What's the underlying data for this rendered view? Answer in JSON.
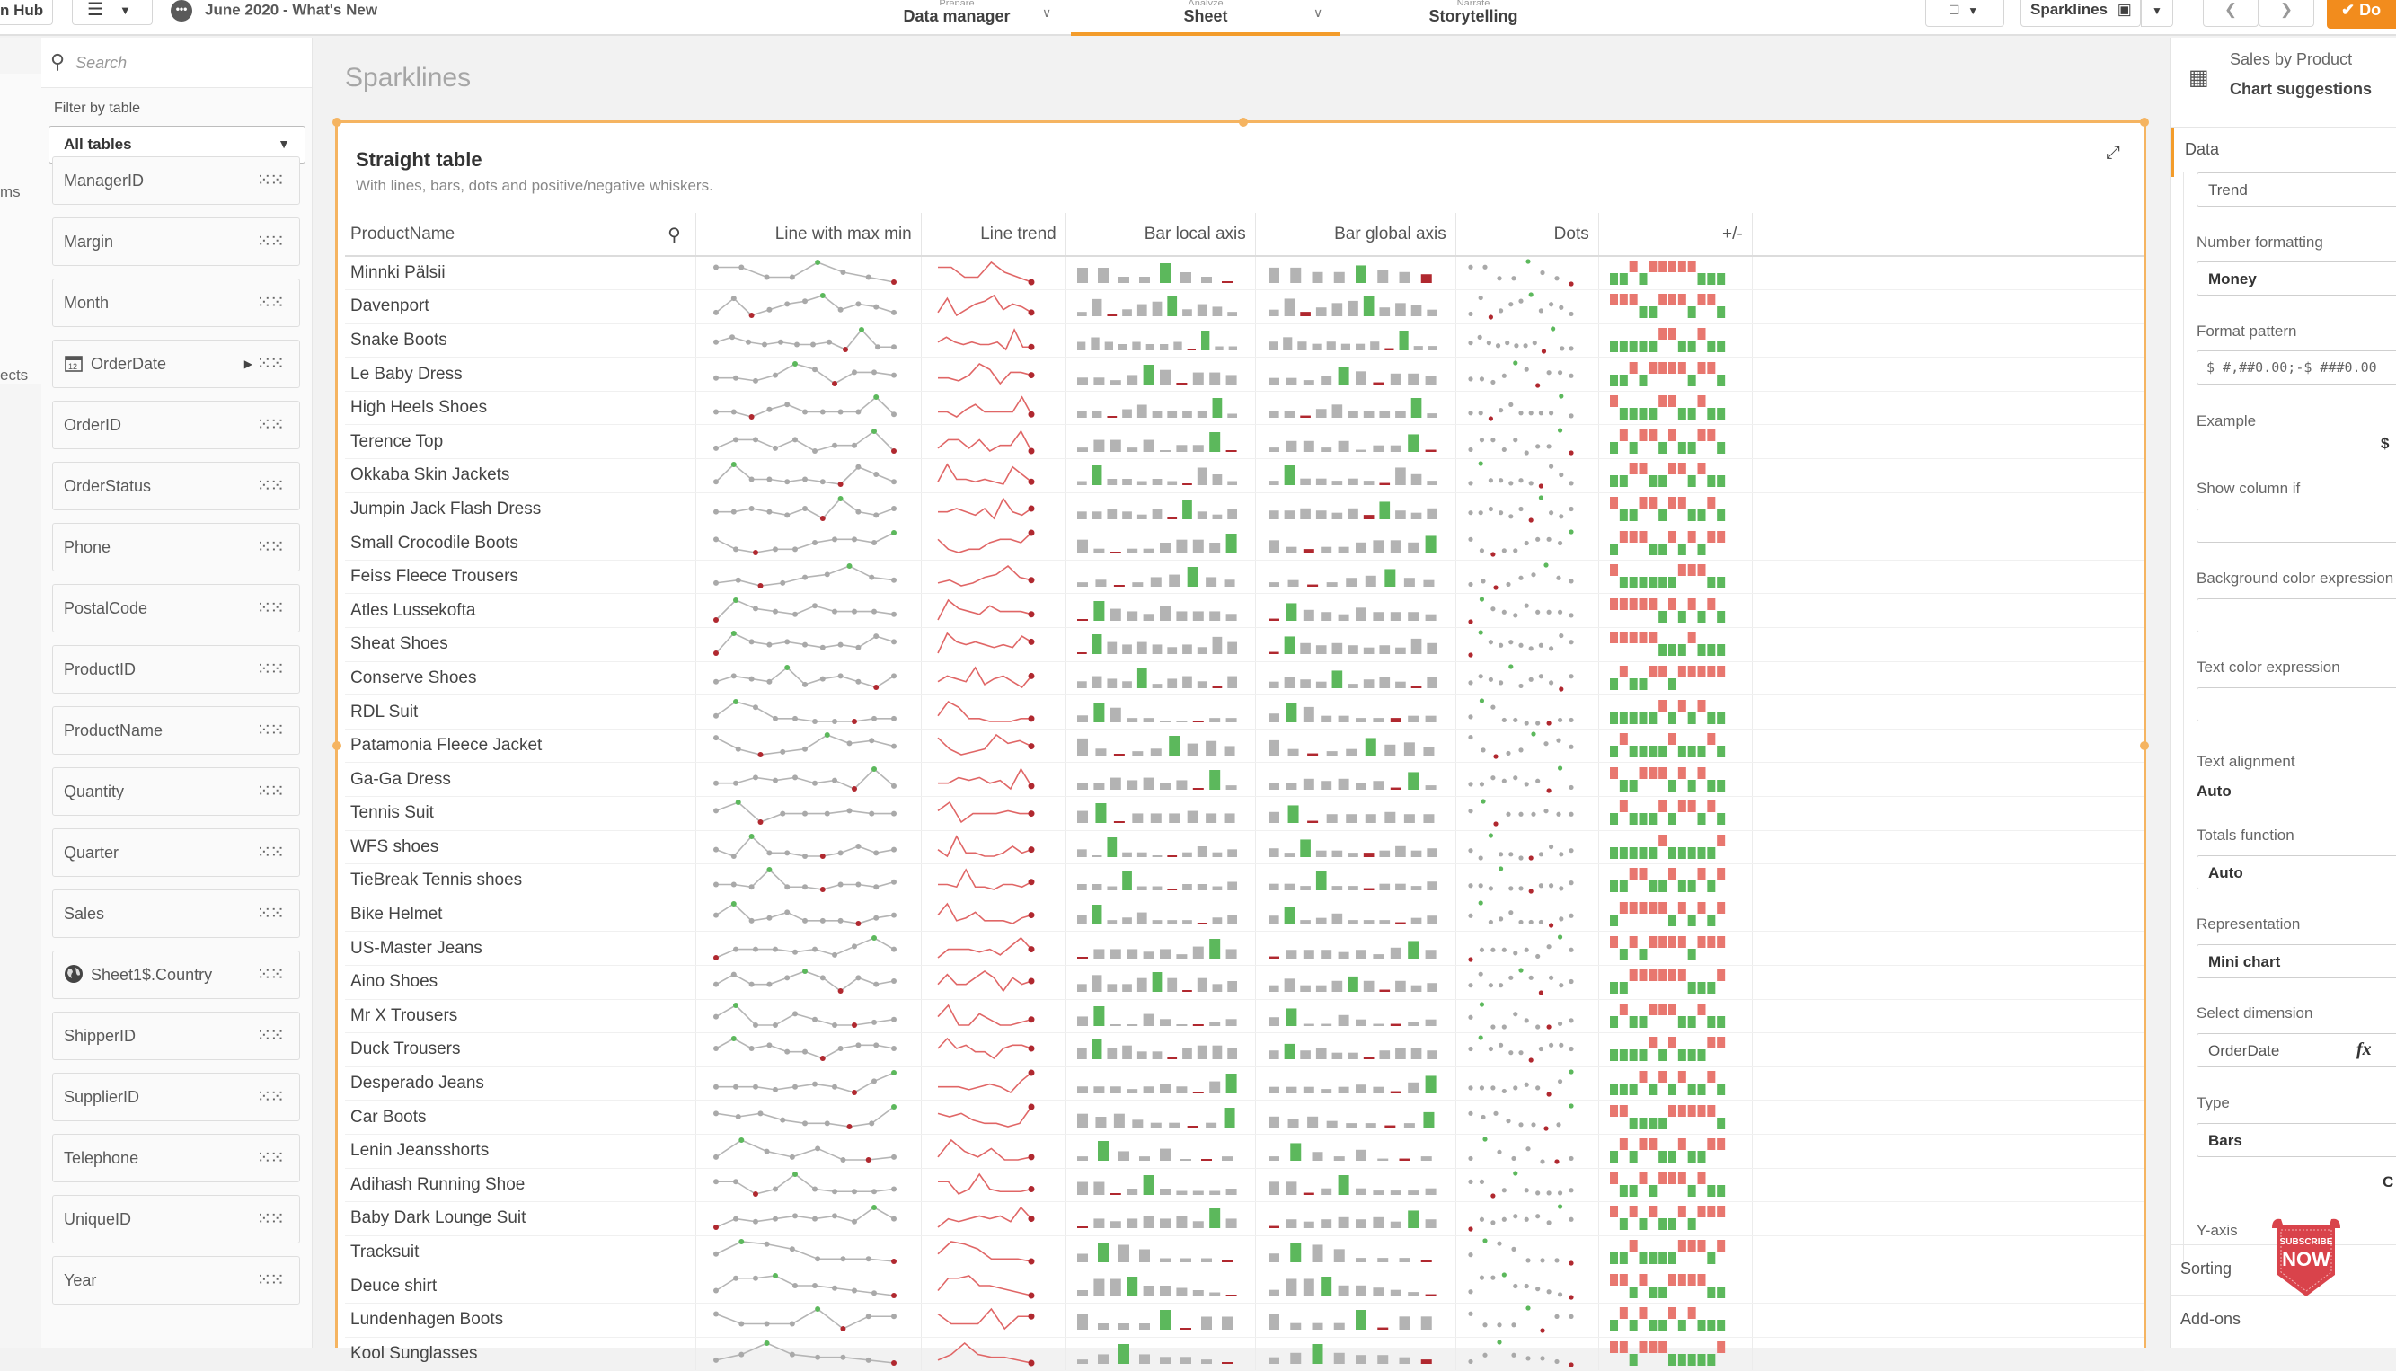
{
  "topbar": {
    "hub_label": "n Hub",
    "app_title": "June 2020 - What's New",
    "tabs": [
      {
        "small": "Prepare",
        "label": "Data manager",
        "active": false
      },
      {
        "small": "Analyze",
        "label": "Sheet",
        "active": true
      },
      {
        "small": "Narrate",
        "label": "Storytelling",
        "active": false
      }
    ],
    "sheet_selector": "Sparklines",
    "done_label": "Do"
  },
  "left_strip": {
    "labels": [
      "ms",
      "ects"
    ]
  },
  "fields_panel": {
    "search_placeholder": "Search",
    "filter_label": "Filter by table",
    "filter_value": "All tables",
    "fields": [
      {
        "name": "ManagerID",
        "icon": null
      },
      {
        "name": "Margin",
        "icon": null
      },
      {
        "name": "Month",
        "icon": null
      },
      {
        "name": "OrderDate",
        "icon": "calendar-icon",
        "expandable": true
      },
      {
        "name": "OrderID",
        "icon": null
      },
      {
        "name": "OrderStatus",
        "icon": null
      },
      {
        "name": "Phone",
        "icon": null
      },
      {
        "name": "PostalCode",
        "icon": null
      },
      {
        "name": "ProductID",
        "icon": null
      },
      {
        "name": "ProductName",
        "icon": null
      },
      {
        "name": "Quantity",
        "icon": null
      },
      {
        "name": "Quarter",
        "icon": null
      },
      {
        "name": "Sales",
        "icon": null
      },
      {
        "name": "Sheet1$.Country",
        "icon": "globe-icon"
      },
      {
        "name": "ShipperID",
        "icon": null
      },
      {
        "name": "SupplierID",
        "icon": null
      },
      {
        "name": "Telephone",
        "icon": null
      },
      {
        "name": "UniqueID",
        "icon": null
      },
      {
        "name": "Year",
        "icon": null
      }
    ]
  },
  "sheet": {
    "title": "Sparklines",
    "card_title": "Straight table",
    "card_subtitle": "With lines, bars, dots and positive/negative whiskers.",
    "columns": [
      "ProductName",
      "Line with max min",
      "Line trend",
      "Bar local axis",
      "Bar global axis",
      "Dots",
      "+/-"
    ],
    "colors": {
      "max": "#5cb85c",
      "min": "#b0282f",
      "neutral": "#a9a9a9",
      "trend": "#e06666",
      "positive": "#5cb85c",
      "negative": "#e8776f"
    },
    "rows": [
      {
        "name": "Minnki Pälsii",
        "v": [
          7,
          7,
          5,
          5,
          8,
          6,
          5,
          4
        ]
      },
      {
        "name": "Davenport",
        "v": [
          3,
          8,
          2,
          4,
          6,
          7,
          9,
          4,
          6,
          5,
          3
        ]
      },
      {
        "name": "Snake Boots",
        "v": [
          4,
          6,
          4,
          3,
          4,
          3,
          3,
          4,
          1,
          9,
          2,
          2
        ]
      },
      {
        "name": "Le Baby Dress",
        "v": [
          3,
          3,
          2,
          4,
          8,
          6,
          1,
          5,
          5,
          4
        ]
      },
      {
        "name": "High Heels Shoes",
        "v": [
          3,
          3,
          1,
          4,
          6,
          3,
          3,
          3,
          3,
          9,
          2
        ]
      },
      {
        "name": "Terence Top",
        "v": [
          2,
          5,
          5,
          2,
          5,
          1,
          3,
          3,
          8,
          1
        ]
      },
      {
        "name": "Okkaba Skin Jackets",
        "v": [
          2,
          9,
          3,
          3,
          2,
          3,
          2,
          1,
          8,
          5,
          2
        ]
      },
      {
        "name": "Jumpin Jack Flash Dress",
        "v": [
          4,
          4,
          5,
          4,
          3,
          5,
          2,
          8,
          4,
          3,
          5
        ]
      },
      {
        "name": "Small Crocodile Boots",
        "v": [
          6,
          3,
          2,
          3,
          3,
          5,
          6,
          6,
          5,
          8
        ]
      },
      {
        "name": "Feiss Fleece Trousers",
        "v": [
          2,
          3,
          1,
          2,
          4,
          5,
          8,
          4,
          3
        ]
      },
      {
        "name": "Atles Lussekofta",
        "v": [
          1,
          8,
          5,
          4,
          3,
          6,
          4,
          4,
          4,
          3
        ]
      },
      {
        "name": "Sheat Shoes",
        "v": [
          1,
          8,
          5,
          4,
          5,
          4,
          3,
          4,
          3,
          7,
          5
        ]
      },
      {
        "name": "Conserve Shoes",
        "v": [
          3,
          5,
          4,
          3,
          8,
          2,
          4,
          5,
          3,
          1,
          5
        ]
      },
      {
        "name": "RDL Suit",
        "v": [
          4,
          9,
          7,
          3,
          3,
          2,
          2,
          2,
          3,
          3
        ]
      },
      {
        "name": "Patamonia Fleece Jacket",
        "v": [
          7,
          3,
          1,
          2,
          3,
          8,
          5,
          6,
          4
        ]
      },
      {
        "name": "Ga-Ga Dress",
        "v": [
          3,
          3,
          5,
          4,
          5,
          3,
          4,
          1,
          8,
          2
        ]
      },
      {
        "name": "Tennis Suit",
        "v": [
          5,
          8,
          1,
          4,
          4,
          4,
          5,
          4,
          4
        ]
      },
      {
        "name": "WFS shoes",
        "v": [
          4,
          2,
          8,
          3,
          3,
          2,
          2,
          3,
          5,
          3,
          4
        ]
      },
      {
        "name": "TieBreak Tennis shoes",
        "v": [
          3,
          3,
          2,
          9,
          2,
          2,
          1,
          3,
          3,
          2,
          4
        ]
      },
      {
        "name": "Bike Helmet",
        "v": [
          4,
          8,
          2,
          3,
          5,
          2,
          2,
          2,
          1,
          3,
          4
        ]
      },
      {
        "name": "US-Master Jeans",
        "v": [
          1,
          4,
          4,
          4,
          3,
          4,
          2,
          5,
          8,
          4
        ]
      },
      {
        "name": "Aino Shoes",
        "v": [
          3,
          6,
          3,
          3,
          5,
          7,
          5,
          1,
          5,
          3,
          4
        ]
      },
      {
        "name": "Mr X Trousers",
        "v": [
          4,
          8,
          1,
          1,
          5,
          3,
          1,
          1,
          2,
          3
        ]
      },
      {
        "name": "Duck Trousers",
        "v": [
          4,
          7,
          4,
          5,
          3,
          3,
          1,
          4,
          5,
          5,
          4
        ]
      },
      {
        "name": "Desperado Jeans",
        "v": [
          3,
          3,
          3,
          2,
          3,
          4,
          3,
          1,
          5,
          8
        ]
      },
      {
        "name": "Car Boots",
        "v": [
          5,
          4,
          5,
          3,
          2,
          2,
          1,
          2,
          7
        ]
      },
      {
        "name": "Lenin Jeansshorts",
        "v": [
          2,
          8,
          4,
          2,
          5,
          1,
          1,
          2
        ]
      },
      {
        "name": "Adihash Running Shoe",
        "v": [
          6,
          6,
          1,
          3,
          9,
          3,
          2,
          2,
          2,
          3
        ]
      },
      {
        "name": "Baby Dark Lounge Suit",
        "v": [
          1,
          4,
          3,
          4,
          5,
          4,
          5,
          3,
          8,
          4
        ]
      },
      {
        "name": "Tracksuit",
        "v": [
          4,
          9,
          8,
          6,
          2,
          2,
          2,
          1
        ]
      },
      {
        "name": "Deuce shirt",
        "v": [
          3,
          8,
          8,
          9,
          5,
          5,
          4,
          3,
          2,
          1
        ]
      },
      {
        "name": "Lundenhagen Boots",
        "v": [
          7,
          3,
          3,
          3,
          9,
          1,
          6,
          6
        ]
      },
      {
        "name": "Kool Sunglasses",
        "v": [
          3,
          5,
          9,
          5,
          4,
          4,
          3,
          2
        ]
      }
    ]
  },
  "props": {
    "object_title": "Sales by Product",
    "chart_suggestions": "Chart suggestions",
    "section_data": "Data",
    "measure_label_value": "Trend",
    "number_formatting_label": "Number formatting",
    "number_formatting_value": "Money",
    "format_pattern_label": "Format pattern",
    "format_pattern_value": "$ #,##0.00;-$ ###0.00",
    "example_label": "Example",
    "example_value": "$",
    "show_column_if_label": "Show column if",
    "bg_color_label": "Background color expression",
    "text_color_label": "Text color expression",
    "text_alignment_label": "Text alignment",
    "text_alignment_value": "Auto",
    "totals_label": "Totals function",
    "totals_value": "Auto",
    "representation_label": "Representation",
    "representation_value": "Mini chart",
    "dimension_label": "Select dimension",
    "dimension_value": "OrderDate",
    "fx_label": "fx",
    "type_label": "Type",
    "type_value": "Bars",
    "cut_letter": "C",
    "yaxis_label": "Y-axis",
    "sorting_label": "Sorting",
    "addons_label": "Add-ons",
    "badge_line1": "SUBSCRIBE",
    "badge_line2": "NOW"
  }
}
